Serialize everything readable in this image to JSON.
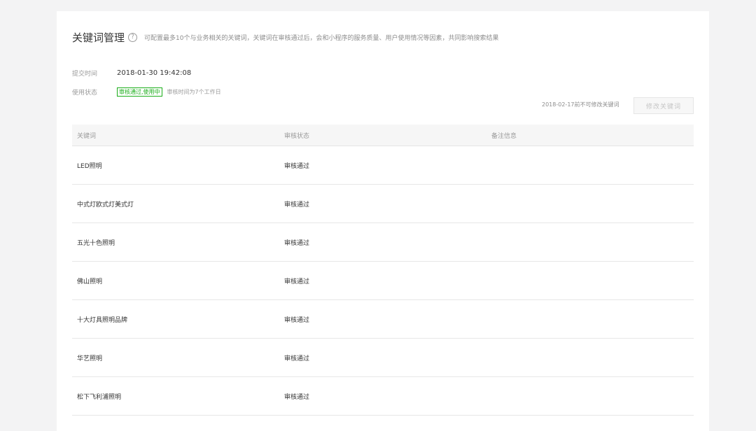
{
  "header": {
    "title": "关键词管理",
    "help_glyph": "?",
    "description": "可配置最多10个与业务相关的关键词，关键词在审核通过后，会和小程序的服务质量、用户使用情况等因素，共同影响搜索结果"
  },
  "meta": {
    "submit_label": "提交时间",
    "submit_value": "2018-01-30 19:42:08",
    "status_label": "使用状态",
    "status_badge": "审核通过,使用中",
    "status_note": "审核时间为7个工作日"
  },
  "actions": {
    "modify_note": "2018-02-17前不可修改关键词",
    "modify_button": "修改关键词"
  },
  "table": {
    "columns": [
      "关键词",
      "审核状态",
      "备注信息"
    ],
    "rows": [
      {
        "keyword": "LED照明",
        "status": "审核通过",
        "remark": ""
      },
      {
        "keyword": "中式灯欧式灯美式灯",
        "status": "审核通过",
        "remark": ""
      },
      {
        "keyword": "五光十色照明",
        "status": "审核通过",
        "remark": ""
      },
      {
        "keyword": "佛山照明",
        "status": "审核通过",
        "remark": ""
      },
      {
        "keyword": "十大灯具照明品牌",
        "status": "审核通过",
        "remark": ""
      },
      {
        "keyword": "华艺照明",
        "status": "审核通过",
        "remark": ""
      },
      {
        "keyword": "松下飞利浦照明",
        "status": "审核通过",
        "remark": ""
      }
    ]
  },
  "colors": {
    "accent_green": "#1aad19",
    "page_background": "#f3f3f4",
    "panel_background": "#ffffff"
  }
}
